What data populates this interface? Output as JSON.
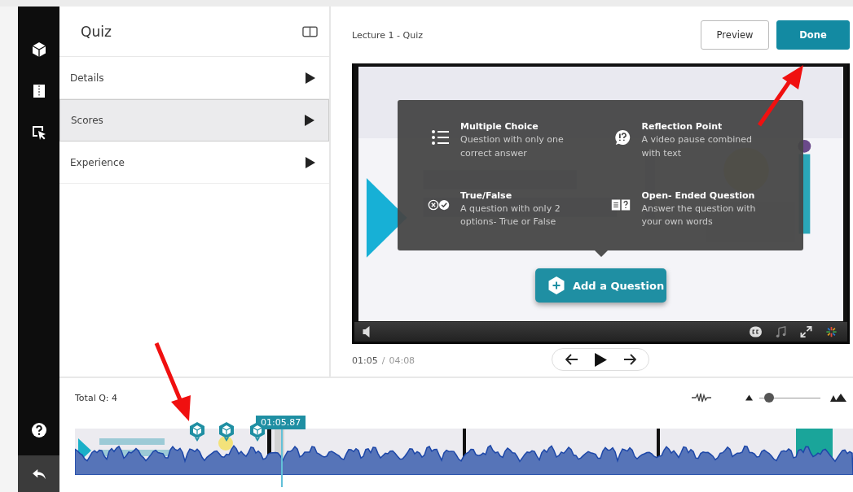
{
  "panel": {
    "title": "Quiz",
    "items": [
      {
        "label": "Details",
        "selected": false
      },
      {
        "label": "Scores",
        "selected": true
      },
      {
        "label": "Experience",
        "selected": false
      }
    ]
  },
  "header": {
    "title": "Lecture 1 - Quiz",
    "buttons": [
      {
        "label": "Preview",
        "kind": "outline"
      },
      {
        "label": "Done",
        "kind": "primary"
      }
    ]
  },
  "question_types": [
    {
      "title": "Multiple Choice",
      "description": "Question with only one correct answer",
      "kind": "list"
    },
    {
      "title": "Reflection Point",
      "description": "A video pause combined with text",
      "kind": "reflection"
    },
    {
      "title": "True/False",
      "description": "A question with only 2 options- True or False",
      "kind": "truefalse"
    },
    {
      "title": "Open- Ended Question",
      "description": "Answer the question with your own words",
      "kind": "open"
    }
  ],
  "add_button": "Add a Question",
  "player": {
    "current_time": "01:05",
    "separator": "/",
    "duration": "04:08"
  },
  "timeline": {
    "total": "Total Q: 4",
    "playhead_time": "01:05.87",
    "zoom": {
      "level": 0.08
    }
  }
}
